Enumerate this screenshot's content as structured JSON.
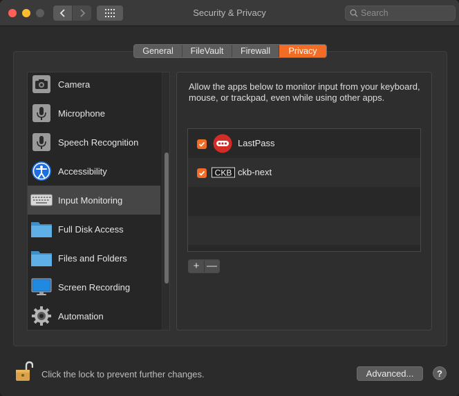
{
  "window": {
    "title": "Security & Privacy"
  },
  "search": {
    "placeholder": "Search"
  },
  "tabs": [
    {
      "label": "General",
      "active": false
    },
    {
      "label": "FileVault",
      "active": false
    },
    {
      "label": "Firewall",
      "active": false
    },
    {
      "label": "Privacy",
      "active": true
    }
  ],
  "sidebar": {
    "items": [
      {
        "label": "Camera",
        "icon": "camera-icon"
      },
      {
        "label": "Microphone",
        "icon": "microphone-icon"
      },
      {
        "label": "Speech Recognition",
        "icon": "speech-recognition-icon"
      },
      {
        "label": "Accessibility",
        "icon": "accessibility-icon"
      },
      {
        "label": "Input Monitoring",
        "icon": "keyboard-icon",
        "selected": true
      },
      {
        "label": "Full Disk Access",
        "icon": "folder-icon"
      },
      {
        "label": "Files and Folders",
        "icon": "folder-icon"
      },
      {
        "label": "Screen Recording",
        "icon": "display-icon"
      },
      {
        "label": "Automation",
        "icon": "gear-icon"
      }
    ]
  },
  "main": {
    "description": "Allow the apps below to monitor input from your keyboard, mouse, or trackpad, even while using other apps.",
    "apps": [
      {
        "name": "LastPass",
        "checked": true,
        "icon": "lastpass-icon"
      },
      {
        "name": "ckb-next",
        "checked": true,
        "icon": "ckb-icon",
        "icon_text": "CKB"
      }
    ],
    "add_label": "+",
    "remove_label": "—"
  },
  "footer": {
    "lock_text": "Click the lock to prevent further changes.",
    "advanced_label": "Advanced...",
    "help_label": "?"
  },
  "colors": {
    "accent": "#f26c26",
    "window_bg": "#2b2b2b",
    "titlebar_bg": "#3a3a3a"
  }
}
